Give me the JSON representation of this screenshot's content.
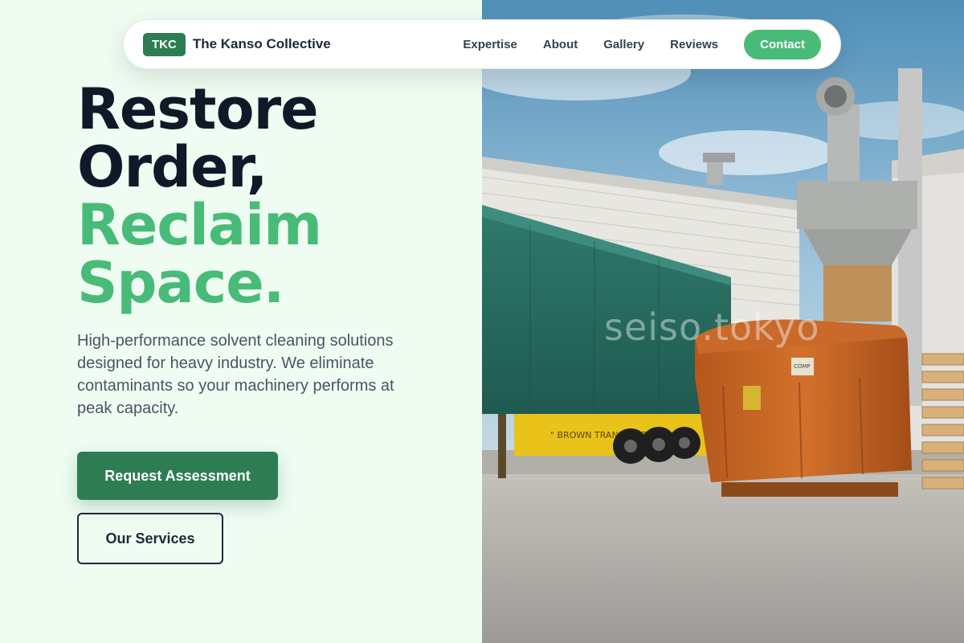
{
  "nav": {
    "logo": "TKC",
    "brand": "The Kanso Collective",
    "links": [
      "Expertise",
      "About",
      "Gallery",
      "Reviews"
    ],
    "cta": "Contact"
  },
  "hero": {
    "headline_dark_1": "Restore",
    "headline_dark_2": "Order,",
    "headline_green_1": "Reclaim",
    "headline_green_2": "Space.",
    "subtitle": "High-performance solvent cleaning solutions designed for heavy industry. We eliminate contaminants so your machinery performs at peak capacity.",
    "primary_button": "Request Assessment",
    "secondary_button": "Our Services"
  },
  "photo": {
    "watermark": "seiso.tokyo",
    "truck_text": "BROWN TRANSPORT",
    "container_label": "COMP"
  },
  "colors": {
    "brand_dark_green": "#2e7d52",
    "accent_green": "#48bb78",
    "text_dark": "#111827",
    "background": "#eefcf2"
  }
}
